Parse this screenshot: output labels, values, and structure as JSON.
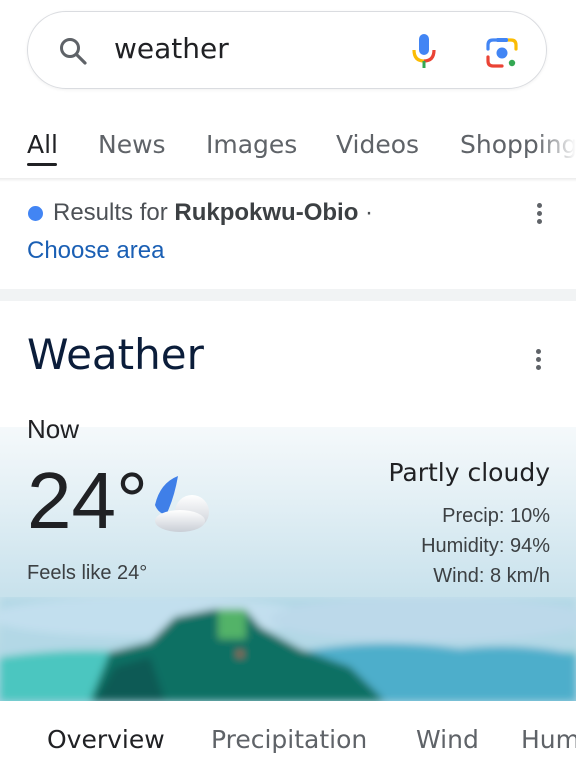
{
  "search": {
    "query": "weather",
    "icons": [
      "search-icon",
      "mic-icon",
      "google-lens-icon"
    ]
  },
  "tabs": [
    {
      "label": "All",
      "active": true
    },
    {
      "label": "News",
      "active": false
    },
    {
      "label": "Images",
      "active": false
    },
    {
      "label": "Videos",
      "active": false
    },
    {
      "label": "Shopping",
      "active": false
    }
  ],
  "location": {
    "prefix": "Results for",
    "place": "Rukpokwu-Obio",
    "separator": "·",
    "choose_area": "Choose area",
    "dot_color": "#4285f4"
  },
  "weather": {
    "title": "Weather",
    "now_label": "Now",
    "temperature": "24°",
    "icon": "partly-cloudy-night-icon",
    "feels_like": "Feels like 24°",
    "condition": "Partly cloudy",
    "precip": "Precip: 10%",
    "humidity": "Humidity: 94%",
    "wind": "Wind: 8 km/h"
  },
  "weather_tabs": [
    {
      "label": "Overview",
      "active": true
    },
    {
      "label": "Precipitation",
      "active": false
    },
    {
      "label": "Wind",
      "active": false
    },
    {
      "label": "Humidity",
      "active": false
    }
  ]
}
